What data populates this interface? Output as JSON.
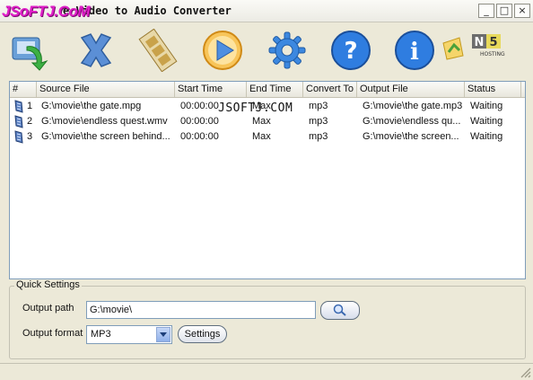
{
  "window": {
    "title": "Alltube Video to Audio Converter",
    "title_partial": "e Video to Audio Converter",
    "logo_text": "JSoFTJ.CoM",
    "controls": [
      "_",
      "□",
      "×"
    ]
  },
  "toolbar": {
    "buttons": [
      {
        "name": "add-files",
        "icon": "add-files-icon"
      },
      {
        "name": "remove",
        "icon": "remove-x-icon"
      },
      {
        "name": "edit-clip",
        "icon": "film-strip-icon"
      },
      {
        "name": "convert",
        "icon": "play-icon"
      },
      {
        "name": "options",
        "icon": "gear-icon"
      },
      {
        "name": "help",
        "icon": "help-question-icon"
      },
      {
        "name": "about",
        "icon": "info-icon"
      }
    ],
    "brand_text": "HOSTING"
  },
  "list": {
    "columns": [
      "#",
      "Source File",
      "Start Time",
      "End Time",
      "Convert To",
      "Output File",
      "Status"
    ],
    "rows": [
      {
        "num": "1",
        "source": "G:\\movie\\the gate.mpg",
        "start": "00:00:00",
        "end": "Max",
        "convert": "mp3",
        "output": "G:\\movie\\the gate.mp3",
        "status": "Waiting"
      },
      {
        "num": "2",
        "source": "G:\\movie\\endless quest.wmv",
        "start": "00:00:00",
        "end": "Max",
        "convert": "mp3",
        "output": "G:\\movie\\endless qu...",
        "status": "Waiting"
      },
      {
        "num": "3",
        "source": "G:\\movie\\the screen behind...",
        "start": "00:00:00",
        "end": "Max",
        "convert": "mp3",
        "output": "G:\\movie\\the screen...",
        "status": "Waiting"
      }
    ],
    "watermark": "JSOFTJ.COM"
  },
  "quick_settings": {
    "title": "Quick Settings",
    "output_path_label": "Output path",
    "output_path_value": "G:\\movie\\",
    "output_format_label": "Output format",
    "output_format_value": "MP3",
    "settings_label": "Settings"
  }
}
